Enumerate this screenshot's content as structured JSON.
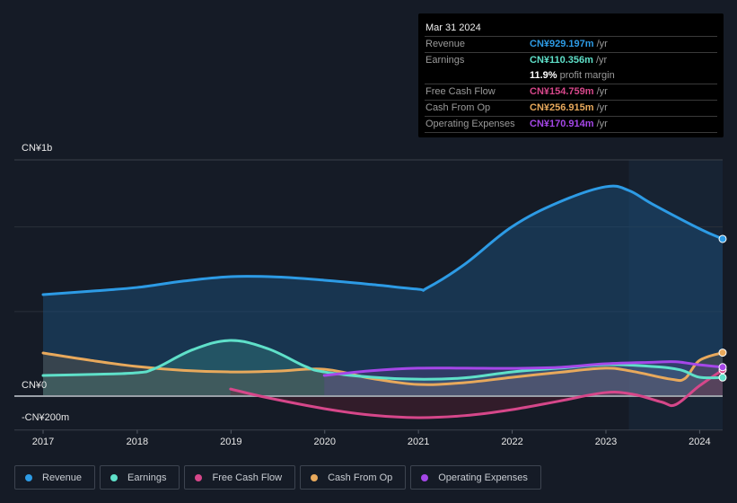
{
  "tooltip": {
    "date": "Mar 31 2024",
    "rows": [
      {
        "label": "Revenue",
        "value": "CN¥929.197m",
        "unit": "/yr",
        "color": "#2d9be5"
      },
      {
        "label": "Earnings",
        "value": "CN¥110.356m",
        "unit": "/yr",
        "color": "#5fe0c9"
      },
      {
        "label": "",
        "value": "11.9%",
        "unit": "profit margin",
        "color": "#ffffff"
      },
      {
        "label": "Free Cash Flow",
        "value": "CN¥154.759m",
        "unit": "/yr",
        "color": "#d6478a"
      },
      {
        "label": "Cash From Op",
        "value": "CN¥256.915m",
        "unit": "/yr",
        "color": "#e8a95c"
      },
      {
        "label": "Operating Expenses",
        "value": "CN¥170.914m",
        "unit": "/yr",
        "color": "#a547e8"
      }
    ]
  },
  "legend": [
    {
      "label": "Revenue",
      "color": "#2d9be5"
    },
    {
      "label": "Earnings",
      "color": "#5fe0c9"
    },
    {
      "label": "Free Cash Flow",
      "color": "#d6478a"
    },
    {
      "label": "Cash From Op",
      "color": "#e8a95c"
    },
    {
      "label": "Operating Expenses",
      "color": "#a547e8"
    }
  ],
  "chart_data": {
    "type": "area",
    "title": "",
    "xlabel": "",
    "ylabel": "",
    "y_unit": "CN¥ millions",
    "xlim": [
      2017.0,
      2024.25
    ],
    "ylim": [
      -200,
      1396
    ],
    "y_tick_labels": [
      {
        "value": 1000,
        "label": "CN¥1b"
      },
      {
        "value": 0,
        "label": "CN¥0"
      },
      {
        "value": -200,
        "label": "-CN¥200m"
      }
    ],
    "gridlines": [
      1000,
      500,
      0
    ],
    "x_ticks": [
      {
        "value": 2017,
        "label": "2017"
      },
      {
        "value": 2018,
        "label": "2018"
      },
      {
        "value": 2019,
        "label": "2019"
      },
      {
        "value": 2020,
        "label": "2020"
      },
      {
        "value": 2021,
        "label": "2021"
      },
      {
        "value": 2022,
        "label": "2022"
      },
      {
        "value": 2023,
        "label": "2023"
      },
      {
        "value": 2024,
        "label": "2024"
      }
    ],
    "highlight_start": 2023.25,
    "legend_position": "bottom-left",
    "grid": true,
    "series": [
      {
        "name": "Revenue",
        "color": "#2d9be5",
        "x": [
          2017.0,
          2017.5,
          2018.0,
          2018.5,
          2019.0,
          2019.5,
          2020.0,
          2020.5,
          2021.0,
          2021.1,
          2021.5,
          2022.0,
          2022.5,
          2023.0,
          2023.25,
          2023.5,
          2024.0,
          2024.25
        ],
        "y": [
          600,
          620,
          642,
          680,
          706,
          704,
          685,
          660,
          632,
          640,
          780,
          1000,
          1145,
          1237,
          1215,
          1135,
          990,
          929
        ]
      },
      {
        "name": "Earnings",
        "color": "#5fe0c9",
        "x": [
          2017.0,
          2017.5,
          2018.0,
          2018.2,
          2018.6,
          2019.0,
          2019.4,
          2019.8,
          2020.0,
          2020.5,
          2021.0,
          2021.5,
          2022.0,
          2022.5,
          2023.0,
          2023.5,
          2023.8,
          2024.0,
          2024.25
        ],
        "y": [
          122,
          128,
          138,
          165,
          275,
          329,
          280,
          175,
          143,
          112,
          100,
          108,
          143,
          165,
          186,
          175,
          155,
          112,
          110
        ]
      },
      {
        "name": "Free Cash Flow",
        "color": "#d6478a",
        "x": [
          2019.0,
          2019.4,
          2020.0,
          2020.5,
          2021.0,
          2021.5,
          2022.0,
          2022.5,
          2023.0,
          2023.3,
          2023.6,
          2023.75,
          2024.0,
          2024.25
        ],
        "y": [
          42,
          -10,
          -74,
          -112,
          -127,
          -115,
          -80,
          -30,
          21,
          10,
          -35,
          -50,
          60,
          155
        ]
      },
      {
        "name": "Cash From Op",
        "color": "#e8a95c",
        "x": [
          2017.0,
          2017.5,
          2018.0,
          2018.5,
          2019.0,
          2019.5,
          2020.0,
          2020.5,
          2021.0,
          2021.5,
          2022.0,
          2022.5,
          2023.0,
          2023.3,
          2023.7,
          2023.85,
          2024.0,
          2024.25
        ],
        "y": [
          255,
          212,
          175,
          152,
          143,
          148,
          159,
          105,
          69,
          80,
          111,
          140,
          165,
          145,
          100,
          105,
          210,
          257
        ]
      },
      {
        "name": "Operating Expenses",
        "color": "#a547e8",
        "x": [
          2020.0,
          2020.5,
          2021.0,
          2021.5,
          2022.0,
          2022.5,
          2023.0,
          2023.5,
          2023.75,
          2024.0,
          2024.25
        ],
        "y": [
          122,
          150,
          165,
          165,
          164,
          170,
          191,
          200,
          203,
          185,
          171
        ]
      }
    ]
  }
}
